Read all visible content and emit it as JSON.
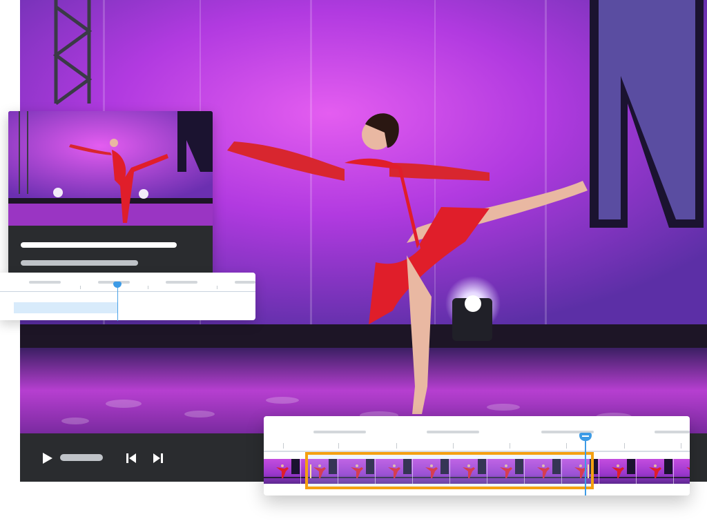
{
  "icons": {
    "play": "play-icon",
    "prev": "skip-back-icon",
    "next": "skip-forward-icon"
  },
  "colors": {
    "selection_border": "#f5a011",
    "playhead": "#3d9be6",
    "stage_purple": "#a02cd6",
    "dress_red": "#e01e2a",
    "controls_bg": "#2a2c2f"
  }
}
